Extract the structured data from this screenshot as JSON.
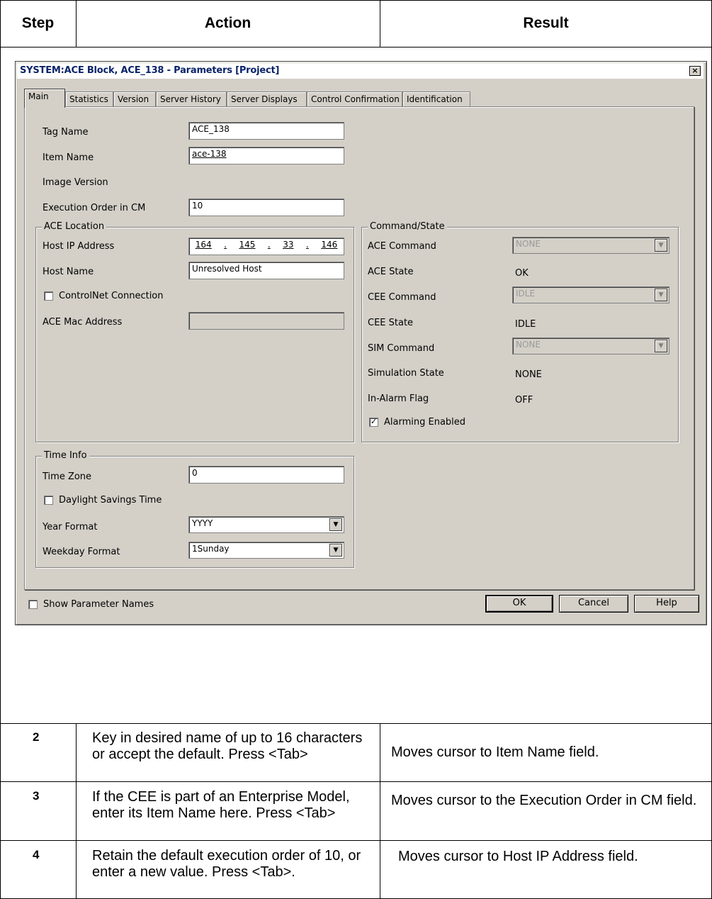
{
  "table": {
    "headers": [
      "Step",
      "Action",
      "Result"
    ],
    "rows": [
      {
        "step": "2",
        "action": "Key in desired name of up to 16 characters or accept the default. Press <Tab>",
        "result": "Moves cursor to Item Name field."
      },
      {
        "step": "3",
        "action": "If the CEE is part of an Enterprise Model, enter its Item Name here. Press <Tab>",
        "result": "Moves cursor to the Execution Order in CM field."
      },
      {
        "step": "4",
        "action": "Retain the default execution order of 10, or enter a new value. Press <Tab>.",
        "result": "Moves cursor to Host IP Address field."
      }
    ]
  },
  "dialog": {
    "title": "SYSTEM:ACE Block, ACE_138 - Parameters [Project]",
    "close_glyph": "×",
    "tabs": [
      "Main",
      "Statistics",
      "Version",
      "Server History",
      "Server Displays",
      "Control Confirmation",
      "Identification"
    ],
    "tag_name_label": "Tag Name",
    "tag_name_value": "ACE_138",
    "item_name_label": "Item Name",
    "item_name_value": "ace-138",
    "image_version_label": "Image Version",
    "exec_order_label": "Execution Order in CM",
    "exec_order_value": "10",
    "ace_location": {
      "title": "ACE Location",
      "host_ip_label": "Host IP Address",
      "ip": [
        "164",
        "145",
        "33",
        "146"
      ],
      "ip_sep": ".",
      "host_name_label": "Host Name",
      "host_name_value": "Unresolved Host",
      "controlnet_label": "ControlNet Connection",
      "controlnet_checked": false,
      "mac_label": "ACE Mac Address",
      "mac_value": ""
    },
    "command_state": {
      "title": "Command/State",
      "ace_command_label": "ACE Command",
      "ace_command_value": "NONE",
      "ace_state_label": "ACE State",
      "ace_state_value": "OK",
      "cee_command_label": "CEE Command",
      "cee_command_value": "IDLE",
      "cee_state_label": "CEE State",
      "cee_state_value": "IDLE",
      "sim_command_label": "SIM Command",
      "sim_command_value": "NONE",
      "sim_state_label": "Simulation State",
      "sim_state_value": "NONE",
      "in_alarm_label": "In-Alarm Flag",
      "in_alarm_value": "OFF",
      "alarming_label": "Alarming Enabled",
      "alarming_checked": true,
      "check_glyph": "✓"
    },
    "time_info": {
      "title": "Time Info",
      "time_zone_label": "Time Zone",
      "time_zone_value": "0",
      "dst_label": "Daylight Savings Time",
      "dst_checked": false,
      "year_format_label": "Year Format",
      "year_format_value": "YYYY",
      "weekday_format_label": "Weekday Format",
      "weekday_format_value": "1Sunday"
    },
    "show_param_names_label": "Show Parameter Names",
    "ok_label": "OK",
    "cancel_label": "Cancel",
    "help_label": "Help",
    "dropdown_glyph": "▼"
  }
}
